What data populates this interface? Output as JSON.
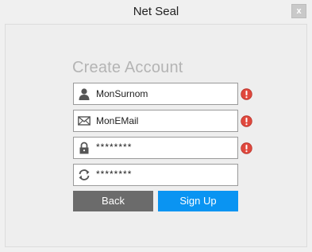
{
  "window": {
    "title": "Net Seal",
    "close_glyph": "x"
  },
  "form": {
    "heading": "Create Account",
    "fields": [
      {
        "name": "name",
        "icon": "user-icon",
        "value": "MonSurnom",
        "has_error": true
      },
      {
        "name": "email",
        "icon": "envelope-icon",
        "value": "MonEMail",
        "has_error": true
      },
      {
        "name": "password",
        "icon": "lock-icon",
        "value": "********",
        "has_error": true
      },
      {
        "name": "confirm-password",
        "icon": "refresh-icon",
        "value": "********",
        "has_error": false
      }
    ],
    "error_icon": "exclamation-icon",
    "back_label": "Back",
    "signup_label": "Sign Up"
  },
  "colors": {
    "signup_button": "#0a94f2",
    "back_button": "#6b6b6b",
    "error": "#e0483d",
    "heading": "#b4b4b4"
  }
}
